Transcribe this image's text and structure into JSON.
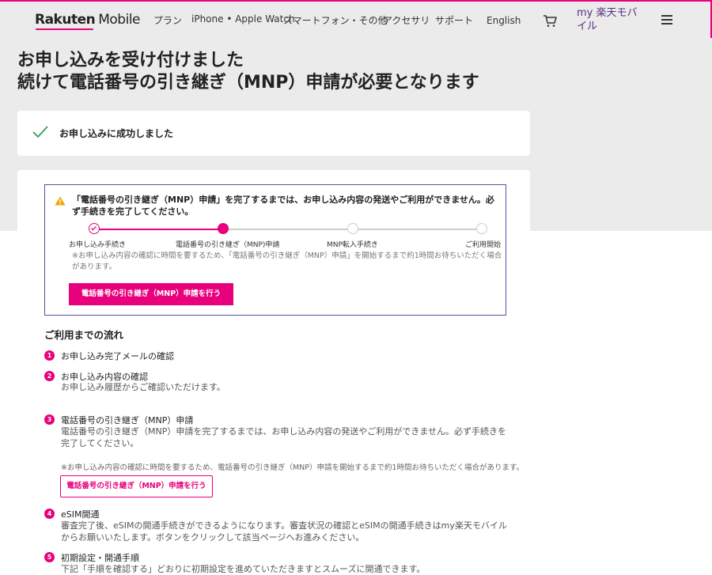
{
  "header": {
    "logo_brand": "Rakuten",
    "logo_product": "Mobile",
    "nav": [
      "プラン",
      "iPhone • Apple Watch",
      "スマートフォン・その他",
      "アクセサリ",
      "サポート",
      "English"
    ],
    "my_link": "my 楽天モバイル",
    "accent_color": "#e8007c"
  },
  "page": {
    "title_line1": "お申し込みを受け付けました",
    "title_line2": "続けて電話番号の引き継ぎ（MNP）申請が必要となります"
  },
  "success": {
    "message": "お申し込みに成功しました"
  },
  "notice": {
    "text": "「電話番号の引き継ぎ（MNP）申請」を完了するまでは、お申し込み内容の発送やご利用ができません。必ず手続きを完了してください。",
    "steps": [
      "お申し込み手続き",
      "電話番号の引き継ぎ（MNP)申請",
      "MNP転入手続き",
      "ご利用開始"
    ],
    "current_step": 2,
    "note": "※お申し込み内容の確認に時間を要するため、「電話番号の引き継ぎ（MNP）申請」を開始するまで約1時間お待ちいただく場合があります。",
    "button_label": "電話番号の引き継ぎ（MNP）申請を行う"
  },
  "flow": {
    "title": "ご利用までの流れ",
    "items": [
      {
        "num": "1",
        "title": "お申し込み完了メールの確認",
        "desc": ""
      },
      {
        "num": "2",
        "title": "お申し込み内容の確認",
        "desc": "お申し込み履歴からご確認いただけます。"
      },
      {
        "num": "3",
        "title": "電話番号の引き継ぎ（MNP）申請",
        "desc": "電話番号の引き継ぎ（MNP）申請を完了するまでは、お申し込み内容の発送やご利用ができません。必ず手続きを完了してください。"
      },
      {
        "num": "4",
        "title": "eSIM開通",
        "desc": "審査完了後、eSIMの開通手続きができるようになります。審査状況の確認とeSIMの開通手続きはmy楽天モバイルからお願いいたします。ボタンをクリックして該当ページへお進みください。"
      },
      {
        "num": "5",
        "title": "初期設定・開通手順",
        "desc": "下記「手順を確認する」どおりに初期設定を進めていただきますとスムーズに開通できます。"
      }
    ],
    "item3_note": "※お申し込み内容の確認に時間を要するため、電話番号の引き継ぎ（MNP）申請を開始するまで約1時間お待ちいただく場合があります。",
    "item3_button": "電話番号の引き継ぎ（MNP）申請を行う"
  }
}
